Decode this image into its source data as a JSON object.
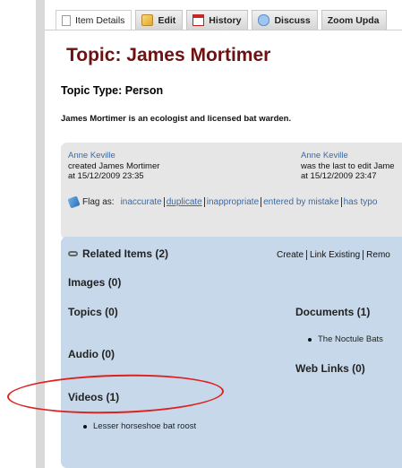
{
  "tabs": [
    {
      "label": "Item Details",
      "icon": "document-icon"
    },
    {
      "label": "Edit",
      "icon": "edit-icon"
    },
    {
      "label": "History",
      "icon": "calendar-icon"
    },
    {
      "label": "Discuss",
      "icon": "discuss-icon"
    },
    {
      "label": "Zoom Upda",
      "icon": ""
    }
  ],
  "page": {
    "title": "Topic: James Mortimer",
    "topic_type": "Topic Type: Person",
    "description": "James Mortimer is an ecologist and licensed bat warden."
  },
  "info": {
    "created": {
      "user": "Anne Keville",
      "action": "created James Mortimer",
      "time": "at 15/12/2009 23:35"
    },
    "edited": {
      "user": "Anne Keville",
      "action": "was the last to edit Jame",
      "time": "at 15/12/2009 23:47"
    },
    "flag_label": "Flag as:",
    "flags": [
      "inaccurate",
      "duplicate",
      "inappropriate",
      "entered by mistake",
      "has typo"
    ]
  },
  "related": {
    "heading": "Related Items (2)",
    "actions": [
      "Create",
      "Link Existing",
      "Remo"
    ],
    "images": "Images (0)",
    "topics": "Topics (0)",
    "documents": "Documents (1)",
    "document_items": [
      "The Noctule Bats"
    ],
    "audio": "Audio (0)",
    "web_links": "Web Links (0)",
    "videos": "Videos (1)",
    "video_items": [
      "Lesser horseshoe bat roost"
    ]
  },
  "colors": {
    "title": "#6d1111",
    "link": "#3a6aa6",
    "panel": "#c6d8ea",
    "highlight": "#e01f1f"
  }
}
